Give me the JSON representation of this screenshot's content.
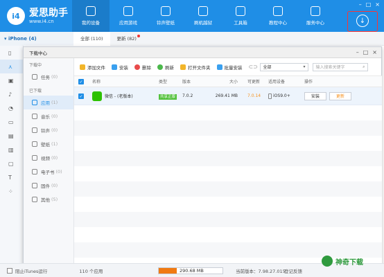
{
  "app": {
    "logo_badge": "i4",
    "logo_title": "爱思助手",
    "logo_url": "www.i4.cn"
  },
  "nav": [
    {
      "label": "我的设备",
      "active": true
    },
    {
      "label": "应用游戏",
      "active": false
    },
    {
      "label": "铃声壁纸",
      "active": false
    },
    {
      "label": "刷机越狱",
      "active": false
    },
    {
      "label": "工具箱",
      "active": false
    },
    {
      "label": "教程中心",
      "active": false
    },
    {
      "label": "服务中心",
      "active": false
    }
  ],
  "device": {
    "label": "iPhone (4)"
  },
  "main_tabs": [
    {
      "label": "全部 (110)"
    },
    {
      "label": "更新 (82)"
    }
  ],
  "download_center": {
    "title": "下载中心",
    "sections": {
      "downloading": "下载中",
      "downloaded": "已下载"
    },
    "task": {
      "label": "任务",
      "count": "(0)"
    },
    "items": [
      {
        "label": "应用",
        "count": "(1)"
      },
      {
        "label": "音乐",
        "count": "(0)"
      },
      {
        "label": "铃声",
        "count": "(0)"
      },
      {
        "label": "壁纸",
        "count": "(1)"
      },
      {
        "label": "视频",
        "count": "(0)"
      },
      {
        "label": "电子书",
        "count": "(0)"
      },
      {
        "label": "固件",
        "count": "(0)"
      },
      {
        "label": "其他",
        "count": "(5)"
      }
    ],
    "toolbar": {
      "add_file": "添加文件",
      "install": "安装",
      "delete": "删除",
      "refresh": "刷新",
      "open_folder": "打开文件夹",
      "batch_install": "批量安装",
      "filter_value": "全部",
      "search_placeholder": "输入搜索关键字"
    },
    "columns": [
      "名称",
      "类型",
      "版本",
      "大小",
      "可更新",
      "适用设备",
      "操作"
    ],
    "rows": [
      {
        "name": "微信 - (老版本)",
        "type": "共享正版",
        "version": "7.0.2",
        "size": "269.41 MB",
        "update": "7.0.14",
        "device": "iOS9.0+",
        "install_btn": "安装",
        "update_btn": "更新"
      }
    ]
  },
  "status": {
    "itunes_label": "阻止iTunes运行",
    "app_count": "110 个应用",
    "storage": "290.68 MB",
    "storage_fill": 0.28,
    "version": "当前版本：7.98.27.015",
    "feedback": "登记反馈",
    "watermark": "神奇下载"
  },
  "colors": {
    "brand": "#1f8ee6",
    "update": "#f7921e",
    "tag": "#54c23e"
  }
}
